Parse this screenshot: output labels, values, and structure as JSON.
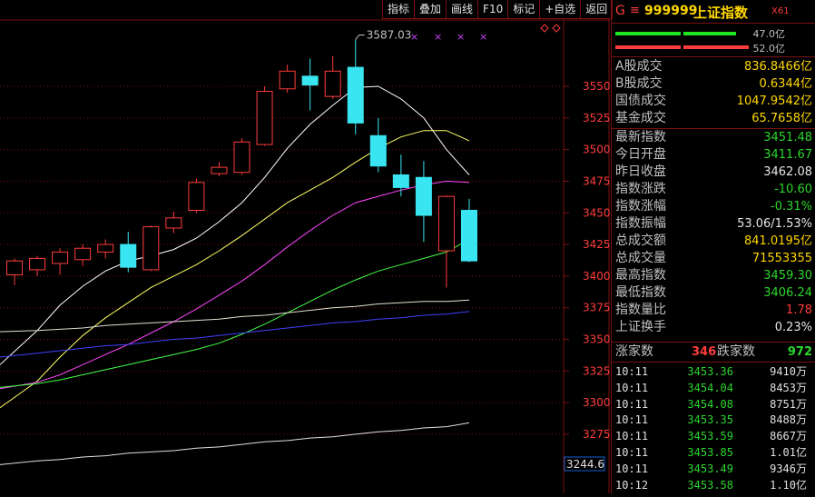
{
  "toolbar": {
    "items": [
      "指标",
      "叠加",
      "画线",
      "F10",
      "标记",
      "+自选",
      "返回"
    ]
  },
  "chart_data": {
    "type": "candlestick",
    "y_axis_ticks": [
      "3550",
      "3525",
      "3500",
      "3475",
      "3450",
      "3425",
      "3400",
      "3375",
      "3350",
      "3325",
      "3300",
      "3275"
    ],
    "high_label": "3587.03",
    "low_tag": "3244.6",
    "colors": {
      "up": "#ff3c3c",
      "down": "#39e5f0",
      "ma5": "#ffffff",
      "ma10": "#ffff66",
      "ma20": "#ff44ff",
      "ma60": "#44ff44",
      "ma120": "#e0e0d0",
      "ma250": "#4040ff"
    },
    "candles": [
      {
        "o": 3401,
        "h": 3414,
        "l": 3393,
        "c": 3412
      },
      {
        "o": 3405,
        "h": 3416,
        "l": 3400,
        "c": 3414
      },
      {
        "o": 3410,
        "h": 3422,
        "l": 3401,
        "c": 3419
      },
      {
        "o": 3413,
        "h": 3425,
        "l": 3408,
        "c": 3422
      },
      {
        "o": 3419,
        "h": 3429,
        "l": 3414,
        "c": 3425
      },
      {
        "o": 3425,
        "h": 3435,
        "l": 3403,
        "c": 3407
      },
      {
        "o": 3405,
        "h": 3440,
        "l": 3404,
        "c": 3439
      },
      {
        "o": 3438,
        "h": 3451,
        "l": 3434,
        "c": 3446
      },
      {
        "o": 3452,
        "h": 3477,
        "l": 3450,
        "c": 3474
      },
      {
        "o": 3481,
        "h": 3490,
        "l": 3479,
        "c": 3486
      },
      {
        "o": 3482,
        "h": 3509,
        "l": 3480,
        "c": 3506
      },
      {
        "o": 3504,
        "h": 3550,
        "l": 3503,
        "c": 3546
      },
      {
        "o": 3548,
        "h": 3567,
        "l": 3545,
        "c": 3562
      },
      {
        "o": 3558,
        "h": 3572,
        "l": 3531,
        "c": 3551
      },
      {
        "o": 3542,
        "h": 3574,
        "l": 3540,
        "c": 3562
      },
      {
        "o": 3565,
        "h": 3587,
        "l": 3512,
        "c": 3521
      },
      {
        "o": 3511,
        "h": 3525,
        "l": 3482,
        "c": 3487
      },
      {
        "o": 3480,
        "h": 3496,
        "l": 3463,
        "c": 3470
      },
      {
        "o": 3478,
        "h": 3491,
        "l": 3427,
        "c": 3448
      },
      {
        "o": 3420,
        "h": 3464,
        "l": 3391,
        "c": 3463
      },
      {
        "o": 3452,
        "h": 3461,
        "l": 3411,
        "c": 3412
      }
    ],
    "ma_lines": {
      "ma5": [
        3330,
        3357,
        3377,
        3392,
        3404,
        3412,
        3416,
        3421,
        3430,
        3443,
        3458,
        3478,
        3501,
        3520,
        3535,
        3549,
        3550,
        3540,
        3525,
        3500,
        3480
      ],
      "ma10": [
        3296,
        3317,
        3336,
        3353,
        3367,
        3379,
        3391,
        3400,
        3409,
        3420,
        3432,
        3445,
        3458,
        3468,
        3478,
        3490,
        3501,
        3510,
        3515,
        3515,
        3507
      ],
      "ma20": [
        3311,
        3316,
        3322,
        3330,
        3338,
        3346,
        3355,
        3364,
        3374,
        3385,
        3396,
        3409,
        3423,
        3436,
        3448,
        3458,
        3463,
        3468,
        3472,
        3475,
        3474
      ],
      "ma60": [
        3312,
        3315,
        3318,
        3322,
        3326,
        3330,
        3334,
        3338,
        3342,
        3347,
        3354,
        3362,
        3371,
        3380,
        3389,
        3397,
        3404,
        3409,
        3414,
        3419,
        3429
      ],
      "ma120": [
        3356,
        3357,
        3358,
        3359,
        3361,
        3362,
        3363,
        3364,
        3365,
        3366,
        3368,
        3369,
        3371,
        3373,
        3375,
        3376,
        3378,
        3379,
        3380,
        3380,
        3381
      ],
      "ma250": [
        3336,
        3339,
        3341,
        3343,
        3345,
        3346,
        3348,
        3350,
        3351,
        3353,
        3355,
        3357,
        3359,
        3361,
        3363,
        3364,
        3366,
        3367,
        3369,
        3370,
        3372
      ],
      "ma_white_low": [
        3251,
        3254,
        3255,
        3257,
        3258,
        3260,
        3261,
        3262,
        3264,
        3265,
        3267,
        3269,
        3270,
        3272,
        3273,
        3275,
        3277,
        3278,
        3280,
        3281,
        3284
      ]
    }
  },
  "panel": {
    "code": "999999",
    "name": "上证指数",
    "g_label": "G",
    "eq": "≡",
    "x_label": "X61",
    "bar1_value": "47.0亿",
    "bar2_value": "52.0亿",
    "rows": [
      {
        "label": "A股成交",
        "value": "836.8466亿",
        "color": "yellow"
      },
      {
        "label": "B股成交",
        "value": "0.6344亿",
        "color": "yellow"
      },
      {
        "label": "国债成交",
        "value": "1047.9542亿",
        "color": "yellow"
      },
      {
        "label": "基金成交",
        "value": "65.7658亿",
        "color": "yellow"
      },
      {
        "label": "最新指数",
        "value": "3451.48",
        "color": "green"
      },
      {
        "label": "今日开盘",
        "value": "3411.67",
        "color": "green"
      },
      {
        "label": "昨日收盘",
        "value": "3462.08",
        "color": "white"
      },
      {
        "label": "指数涨跌",
        "value": "-10.60",
        "color": "green"
      },
      {
        "label": "指数涨幅",
        "value": "-0.31%",
        "color": "green"
      },
      {
        "label": "指数振幅",
        "value": "53.06/1.53%",
        "color": "white"
      },
      {
        "label": "总成交额",
        "value": "841.0195亿",
        "color": "yellow"
      },
      {
        "label": "总成交量",
        "value": "71553355",
        "color": "yellow"
      },
      {
        "label": "最高指数",
        "value": "3459.30",
        "color": "green"
      },
      {
        "label": "最低指数",
        "value": "3406.24",
        "color": "green"
      },
      {
        "label": "指数量比",
        "value": "1.78",
        "color": "red"
      },
      {
        "label": "上证换手",
        "value": "0.23%",
        "color": "white"
      }
    ],
    "adv_label": "涨家数",
    "adv_value": "346",
    "dec_label": "跌家数",
    "dec_value": "972",
    "ticks": [
      {
        "time": "10:11",
        "price": "3453.36",
        "vol": "9410万"
      },
      {
        "time": "10:11",
        "price": "3454.04",
        "vol": "8453万"
      },
      {
        "time": "10:11",
        "price": "3454.08",
        "vol": "8751万"
      },
      {
        "time": "10:11",
        "price": "3453.35",
        "vol": "8488万"
      },
      {
        "time": "10:11",
        "price": "3453.59",
        "vol": "8667万"
      },
      {
        "time": "10:11",
        "price": "3453.85",
        "vol": "1.01亿"
      },
      {
        "time": "10:11",
        "price": "3453.49",
        "vol": "9346万"
      },
      {
        "time": "10:12",
        "price": "3453.58",
        "vol": "1.10亿"
      }
    ]
  }
}
